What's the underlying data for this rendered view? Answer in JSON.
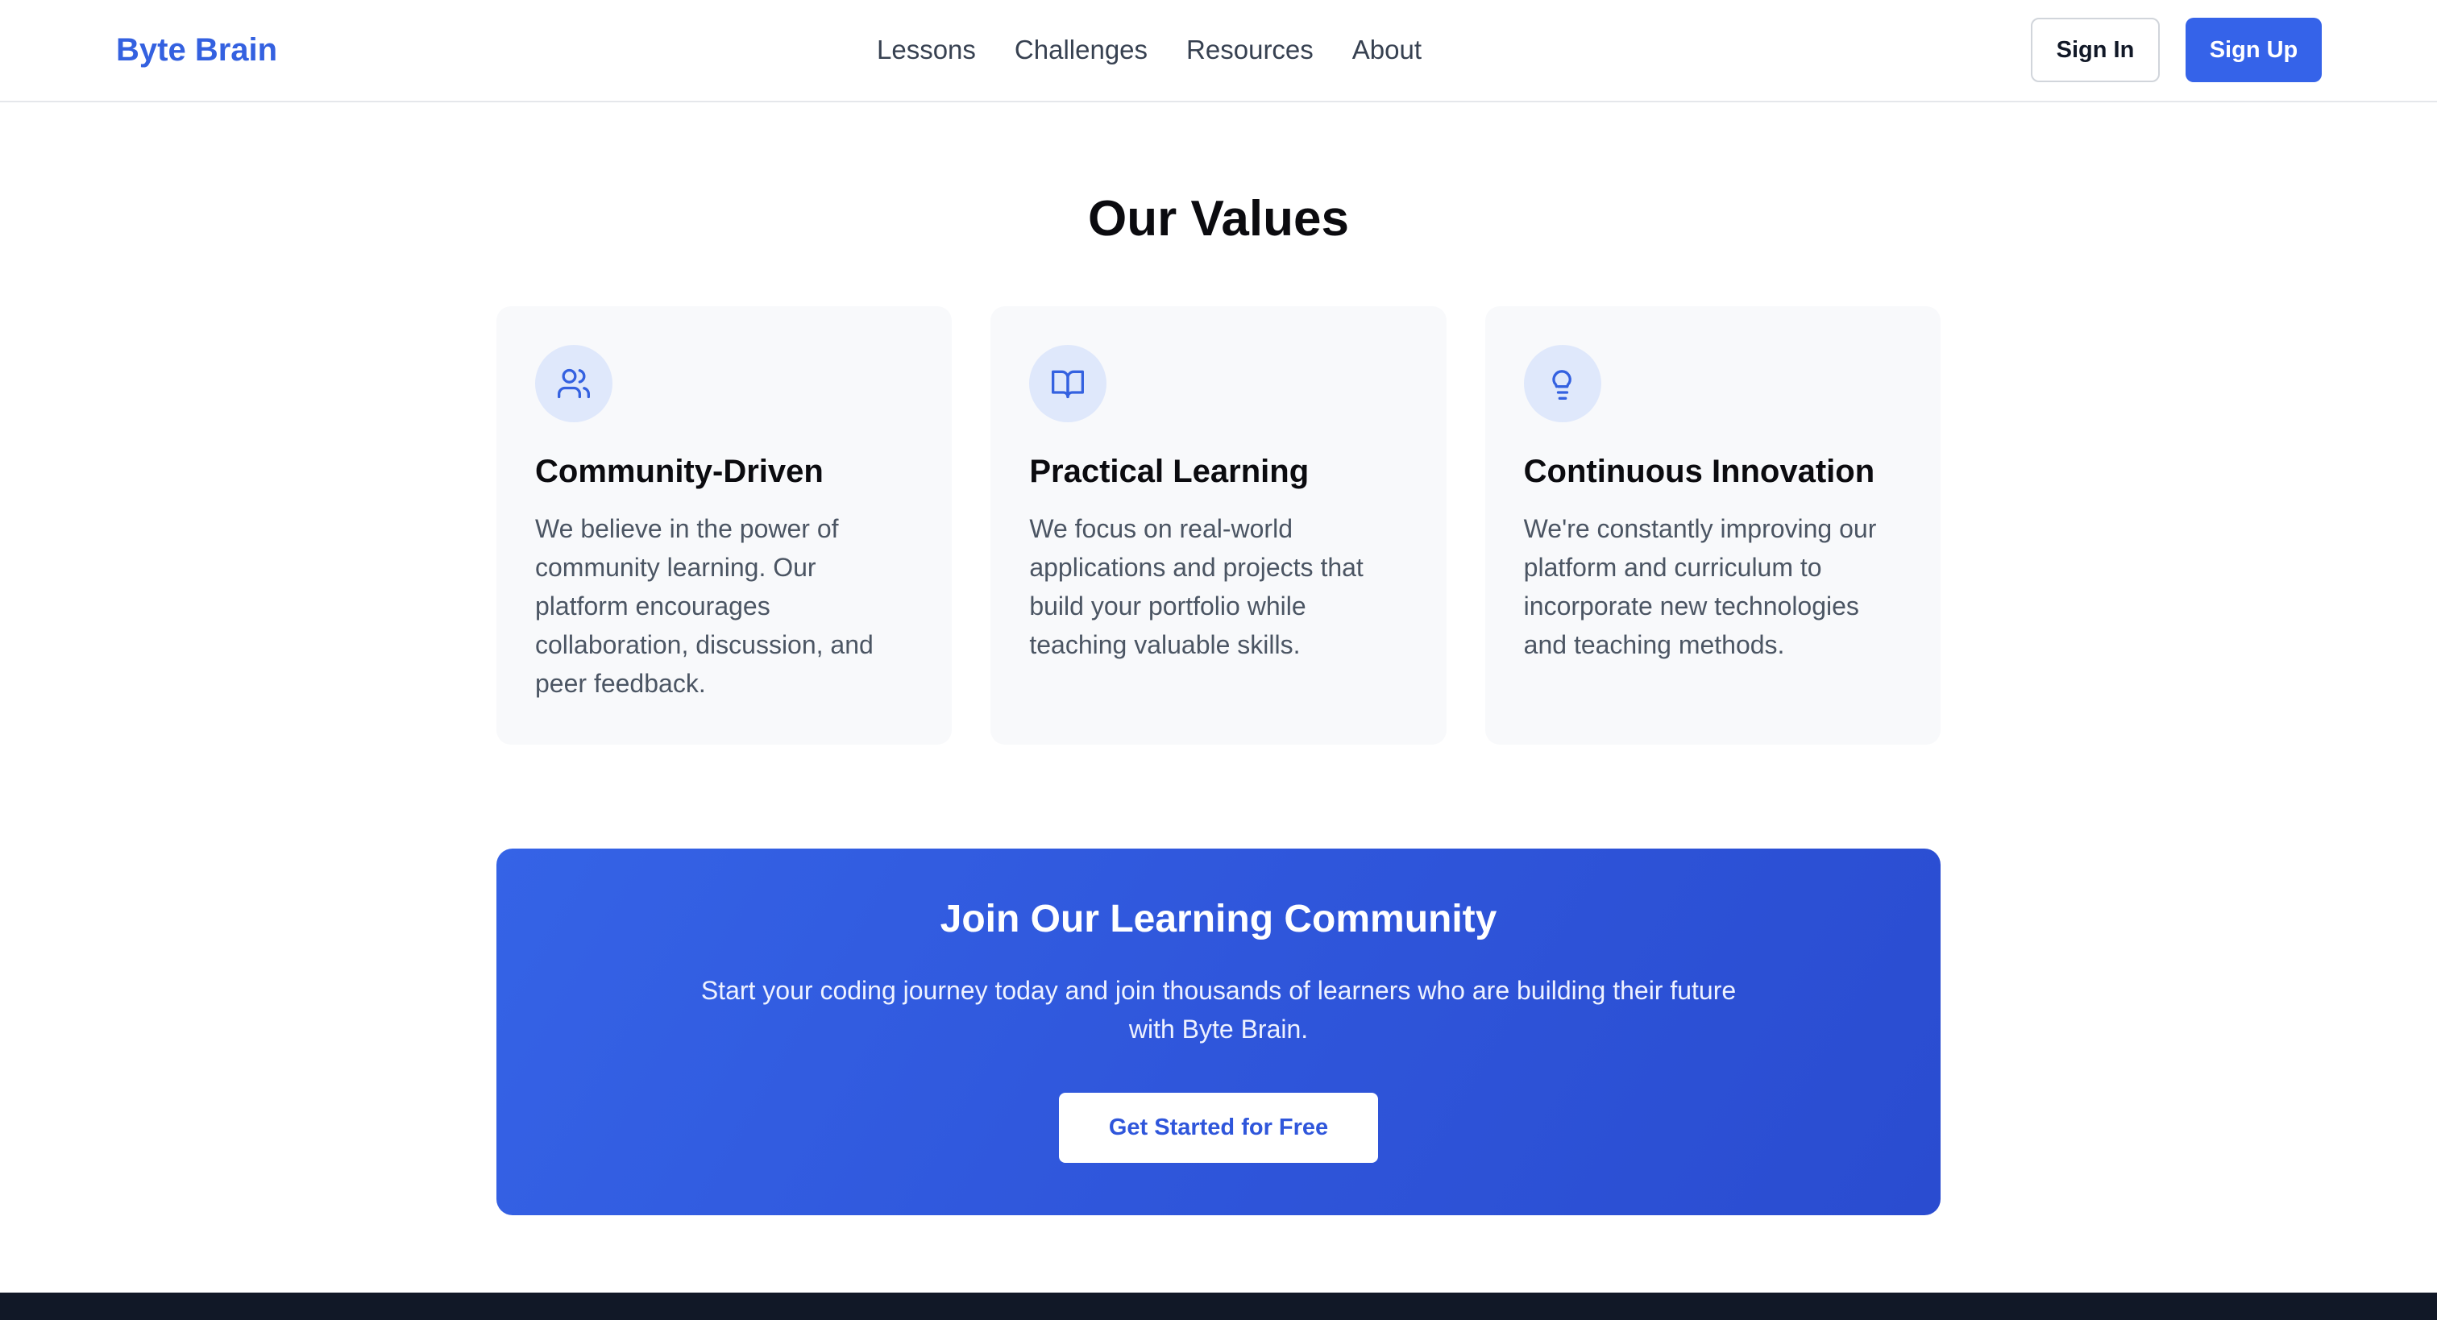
{
  "header": {
    "logo": "Byte Brain",
    "nav": [
      "Lessons",
      "Challenges",
      "Resources",
      "About"
    ],
    "sign_in": "Sign In",
    "sign_up": "Sign Up"
  },
  "values": {
    "title": "Our Values",
    "cards": [
      {
        "icon": "users-icon",
        "title": "Community-Driven",
        "text": "We believe in the power of community learning. Our platform encourages collaboration, discussion, and peer feedback."
      },
      {
        "icon": "book-open-icon",
        "title": "Practical Learning",
        "text": "We focus on real-world applications and projects that build your portfolio while teaching valuable skills."
      },
      {
        "icon": "lightbulb-icon",
        "title": "Continuous Innovation",
        "text": "We're constantly improving our platform and curriculum to incorporate new technologies and teaching methods."
      }
    ]
  },
  "cta": {
    "title": "Join Our Learning Community",
    "text": "Start your coding journey today and join thousands of learners who are building their future with Byte Brain.",
    "button": "Get Started for Free"
  },
  "colors": {
    "brand": "#3563e9",
    "card_bg": "#f8f9fb",
    "icon_bg": "#dfe8fb",
    "footer": "#111827"
  }
}
